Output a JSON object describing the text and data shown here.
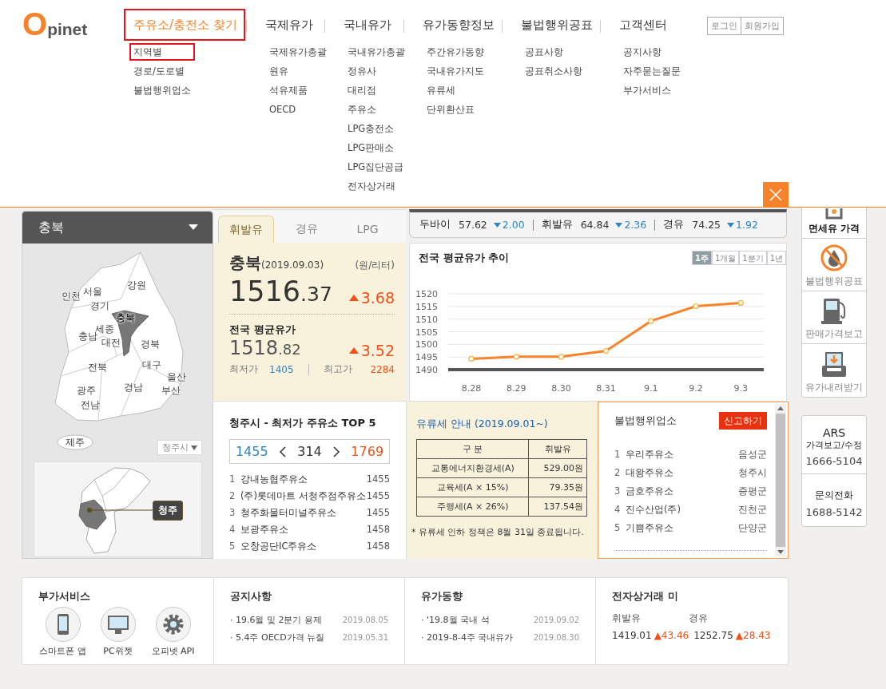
{
  "logo": {
    "letter": "O",
    "text": "pinet"
  },
  "nav": [
    {
      "label": "주유소/충전소 찾기",
      "selected": true,
      "boxed": true,
      "items": [
        {
          "label": "지역별",
          "boxed": true
        },
        {
          "label": "경로/도로별",
          "boxed": false
        },
        {
          "label": "불법행위업소",
          "boxed": false
        }
      ]
    },
    {
      "label": "국제유가",
      "selected": false,
      "boxed": false,
      "items": [
        {
          "label": "국제유가총괄",
          "boxed": false
        },
        {
          "label": "원유",
          "boxed": false
        },
        {
          "label": "석유제품",
          "boxed": false
        },
        {
          "label": "OECD",
          "boxed": false
        }
      ]
    },
    {
      "label": "국내유가",
      "selected": false,
      "boxed": false,
      "items": [
        {
          "label": "국내유가총괄",
          "boxed": false
        },
        {
          "label": "정유사",
          "boxed": false
        },
        {
          "label": "대리점",
          "boxed": false
        },
        {
          "label": "주유소",
          "boxed": false
        },
        {
          "label": "LPG충전소",
          "boxed": false
        },
        {
          "label": "LPG판매소",
          "boxed": false
        },
        {
          "label": "LPG집단공급",
          "boxed": false
        },
        {
          "label": "전자상거래",
          "boxed": false
        }
      ]
    },
    {
      "label": "유가동향정보",
      "selected": false,
      "boxed": false,
      "items": [
        {
          "label": "주간유가동향",
          "boxed": false
        },
        {
          "label": "국내유가지도",
          "boxed": false
        },
        {
          "label": "유류세",
          "boxed": false
        },
        {
          "label": "단위환산표",
          "boxed": false
        }
      ]
    },
    {
      "label": "불법행위공표",
      "selected": false,
      "boxed": false,
      "items": [
        {
          "label": "공표사항",
          "boxed": false
        },
        {
          "label": "공표취소사항",
          "boxed": false
        }
      ]
    },
    {
      "label": "고객센터",
      "selected": false,
      "boxed": false,
      "items": [
        {
          "label": "공지사항",
          "boxed": false
        },
        {
          "label": "자주묻는질문",
          "boxed": false
        },
        {
          "label": "부가서비스",
          "boxed": false
        }
      ]
    }
  ],
  "account_links": [
    "로그인",
    "회원가입"
  ],
  "region_panel": {
    "title": "충북",
    "map_labels": [
      {
        "name": "강원",
        "selected": false
      },
      {
        "name": "서울",
        "selected": false
      },
      {
        "name": "인천",
        "selected": false
      },
      {
        "name": "경기",
        "selected": false
      },
      {
        "name": "충북",
        "selected": true
      },
      {
        "name": "세종",
        "selected": false
      },
      {
        "name": "충남",
        "selected": false
      },
      {
        "name": "대전",
        "selected": false
      },
      {
        "name": "경북",
        "selected": false
      },
      {
        "name": "대구",
        "selected": false
      },
      {
        "name": "전북",
        "selected": false
      },
      {
        "name": "울산",
        "selected": false
      },
      {
        "name": "광주",
        "selected": false
      },
      {
        "name": "경남",
        "selected": false
      },
      {
        "name": "부산",
        "selected": false
      },
      {
        "name": "전남",
        "selected": false
      },
      {
        "name": "제주",
        "selected": false
      }
    ],
    "city_select": "청주시",
    "inset_label": "청주"
  },
  "fuel_tabs": [
    {
      "label": "휘발유",
      "selected": true
    },
    {
      "label": "경유",
      "selected": false
    },
    {
      "label": "LPG",
      "selected": false
    }
  ],
  "price_box": {
    "region": "충북",
    "date": "(2019.09.03)",
    "unit": "(원/리터)",
    "price": "1516.37",
    "change": "3.68",
    "rising": true,
    "national_title": "전국 평균유가",
    "national_price": "1518.82",
    "national_change": "3.52",
    "national_rising": true,
    "min_label": "최저가",
    "min_value": "1405",
    "max_label": "최고가",
    "max_value": "2284"
  },
  "top5": {
    "title": "청주시 - 최저가 주유소 TOP 5",
    "low": "1455",
    "count": "314",
    "high": "1769",
    "rows": [
      {
        "rank": "1",
        "name": "강내농협주유소",
        "price": "1455"
      },
      {
        "rank": "2",
        "name": "(주)롯데마트 서청주점주유소",
        "price": "1455"
      },
      {
        "rank": "3",
        "name": "청주화물터미널주유소",
        "price": "1455"
      },
      {
        "rank": "4",
        "name": "보광주유소",
        "price": "1458"
      },
      {
        "rank": "5",
        "name": "오창공단IC주유소",
        "price": "1458"
      }
    ]
  },
  "ticker": [
    {
      "name": "두바이",
      "value": "57.62",
      "change": "2.00",
      "rising": false
    },
    {
      "name": "휘발유",
      "value": "64.84",
      "change": "2.36",
      "rising": false
    },
    {
      "name": "경유",
      "value": "74.25",
      "change": "1.92",
      "rising": false
    }
  ],
  "trend": {
    "title": "전국 평균유가 추이",
    "periods": [
      {
        "label": "1주",
        "selected": true
      },
      {
        "label": "1개월",
        "selected": false
      },
      {
        "label": "1분기",
        "selected": false
      },
      {
        "label": "1년",
        "selected": false
      }
    ],
    "chart_data": {
      "type": "line",
      "categories": [
        "8.28",
        "8.29",
        "8.30",
        "8.31",
        "9.1",
        "9.2",
        "9.3"
      ],
      "series": [
        {
          "color": "#f7842d",
          "marker": true,
          "values": [
            1494.3,
            1495.1,
            1495.1,
            1497.4,
            1509.2,
            1515.1,
            1516.4
          ]
        }
      ],
      "ylim": [
        1490,
        1520
      ],
      "yticks": [
        1490,
        1495,
        1500,
        1505,
        1510,
        1515,
        1520
      ],
      "grid": true
    }
  },
  "tax": {
    "title": "유류세 안내 (2019.09.01~)",
    "columns": [
      "구 분",
      "휘발유"
    ],
    "rows": [
      [
        "교통에너지환경세(A)",
        "529.00원"
      ],
      [
        "교육세(A × 15%)",
        "79.35원"
      ],
      [
        "주행세(A × 26%)",
        "137.54원"
      ]
    ],
    "note": "* 유류세 인하 정책은 8월 31일 종료됩니다."
  },
  "illegal": {
    "title": "불법행위업소",
    "report_button": "신고하기",
    "rows": [
      {
        "rank": "1",
        "name": "우리주유소",
        "area": "음성군"
      },
      {
        "rank": "2",
        "name": "대왕주유소",
        "area": "청주시"
      },
      {
        "rank": "3",
        "name": "금호주유소",
        "area": "증평군"
      },
      {
        "rank": "4",
        "name": "진수산업(주)",
        "area": "진천군"
      },
      {
        "rank": "5",
        "name": "기쁨주유소",
        "area": "단양군"
      }
    ]
  },
  "quick_menu": [
    {
      "label": "면세유 가격",
      "kind": "taxfree",
      "selected": true
    },
    {
      "label": "불법행위공표",
      "kind": "ban",
      "selected": false
    },
    {
      "label": "판매가격보고",
      "kind": "pump",
      "selected": false
    },
    {
      "label": "유가내려받기",
      "kind": "download",
      "selected": false
    }
  ],
  "contact": {
    "ars_title": "ARS",
    "ars_subtitle": "가격보고/수정",
    "ars_phone": "1666-5104",
    "inquiry_title": "문의전화",
    "inquiry_phone": "1688-5142"
  },
  "footer": {
    "services": {
      "title": "부가서비스",
      "items": [
        {
          "label": "스마트폰 앱",
          "kind": "phone"
        },
        {
          "label": "PC위젯",
          "kind": "monitor"
        },
        {
          "label": "오피넷 API",
          "kind": "gear"
        }
      ]
    },
    "notices": {
      "title": "공지사항",
      "items": [
        {
          "text": "· 19.6월 및 2분기 용제",
          "date": "2019.08.05"
        },
        {
          "text": "· 5.4주 OECD가격 뉴질",
          "date": "2019.05.31"
        }
      ]
    },
    "trends": {
      "title": "유가동향",
      "items": [
        {
          "text": "· '19.8월 국내 석",
          "date": "2019.09.02"
        },
        {
          "text": "· 2019-8-4주 국내유가",
          "date": "2019.08.30"
        }
      ]
    },
    "ecommerce": {
      "title": "전자상거래 미",
      "labels": [
        "휘발유",
        "경유"
      ],
      "values": [
        {
          "price": "1419.01",
          "change": "▲43.46"
        },
        {
          "price": "1252.75",
          "change": "▲28.43"
        }
      ]
    }
  }
}
